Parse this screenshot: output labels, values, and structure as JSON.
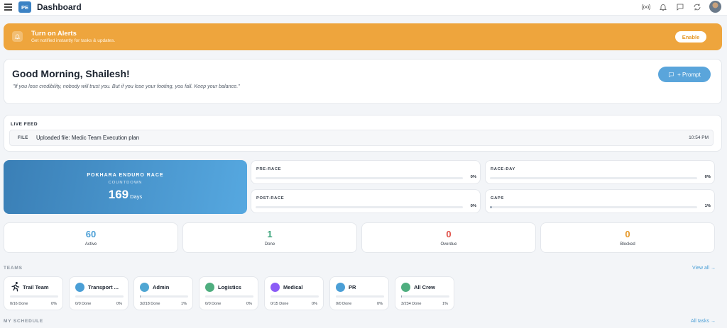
{
  "header": {
    "logo_text": "PE",
    "title": "Dashboard",
    "icons": [
      "menu-icon",
      "broadcast-icon",
      "bell-icon",
      "chat-icon",
      "refresh-icon",
      "user-avatar"
    ]
  },
  "alert": {
    "title": "Turn on Alerts",
    "subtitle": "Get notified instantly for tasks & updates.",
    "button": "Enable",
    "color": "#eea53d"
  },
  "greeting": {
    "title": "Good Morning, Shailesh!",
    "quote": "\"If you lose credibility, nobody will trust you. But if you lose your footing, you fall. Keep your balance.\"",
    "prompt_button": "+ Prompt"
  },
  "live_feed": {
    "heading": "LIVE FEED",
    "items": [
      {
        "tag": "FILE",
        "text": "Uploaded file: Medic Team Execution plan",
        "time": "10:54 PM"
      }
    ]
  },
  "race": {
    "name": "POKHARA ENDURO RACE",
    "label": "COUNTDOWN",
    "count": "169",
    "unit": "Days"
  },
  "phases": [
    {
      "name": "PRE-RACE",
      "pct": "0%",
      "progress": 0
    },
    {
      "name": "RACE-DAY",
      "pct": "0%",
      "progress": 0
    },
    {
      "name": "POST-RACE",
      "pct": "0%",
      "progress": 0
    },
    {
      "name": "GAPS",
      "pct": "1%",
      "progress": 1
    }
  ],
  "stats": [
    {
      "value": "60",
      "label": "Active",
      "color": "#4b9fd6"
    },
    {
      "value": "1",
      "label": "Done",
      "color": "#3aa37a"
    },
    {
      "value": "0",
      "label": "Overdue",
      "color": "#e0524a"
    },
    {
      "value": "0",
      "label": "Blocked",
      "color": "#e69a2c"
    }
  ],
  "teams_section": {
    "label": "TEAMS",
    "link": "View all →"
  },
  "teams": [
    {
      "name": "Trail Team",
      "done": "0/16 Done",
      "pct": "0%",
      "progress": 0,
      "color": "",
      "icon": "running-person-icon"
    },
    {
      "name": "Transport ...",
      "done": "0/0 Done",
      "pct": "0%",
      "progress": 0,
      "color": "#4b9fd6"
    },
    {
      "name": "Admin",
      "done": "3/218 Done",
      "pct": "1%",
      "progress": 1,
      "color": "#4fa6d3"
    },
    {
      "name": "Logistics",
      "done": "0/0 Done",
      "pct": "0%",
      "progress": 0,
      "color": "#4fae7f"
    },
    {
      "name": "Medical",
      "done": "0/15 Done",
      "pct": "0%",
      "progress": 0,
      "color": "#8b5cf6"
    },
    {
      "name": "PR",
      "done": "0/0 Done",
      "pct": "0%",
      "progress": 0,
      "color": "#4b9fd6"
    },
    {
      "name": "All Crew",
      "done": "3/234 Done",
      "pct": "1%",
      "progress": 1,
      "color": "#4fae7f"
    }
  ],
  "schedule_section": {
    "label": "MY SCHEDULE",
    "link": "All tasks →"
  }
}
